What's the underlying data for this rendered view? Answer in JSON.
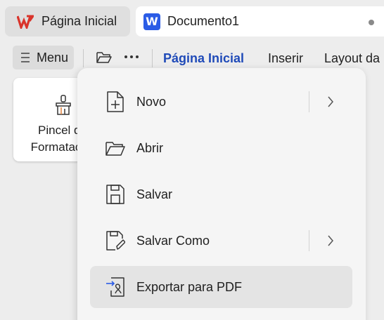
{
  "tabs": {
    "home_label": "Página Inicial",
    "doc_label": "Documento1"
  },
  "ribbon": {
    "menu_label": "Menu",
    "tabs": [
      "Página Inicial",
      "Inserir",
      "Layout da"
    ]
  },
  "card": {
    "line1": "Pincel de",
    "line2": "Formatação"
  },
  "menu": {
    "items": [
      {
        "label": "Novo",
        "icon": "new-document-icon",
        "has_submenu": true
      },
      {
        "label": "Abrir",
        "icon": "folder-open-icon",
        "has_submenu": false
      },
      {
        "label": "Salvar",
        "icon": "save-icon",
        "has_submenu": false
      },
      {
        "label": "Salvar Como",
        "icon": "save-as-icon",
        "has_submenu": true
      },
      {
        "label": "Exportar para PDF",
        "icon": "export-pdf-icon",
        "has_submenu": false
      }
    ]
  },
  "colors": {
    "accent": "#1f4ab8",
    "wps_red": "#d9342b",
    "writer_blue": "#2b5ce6"
  }
}
